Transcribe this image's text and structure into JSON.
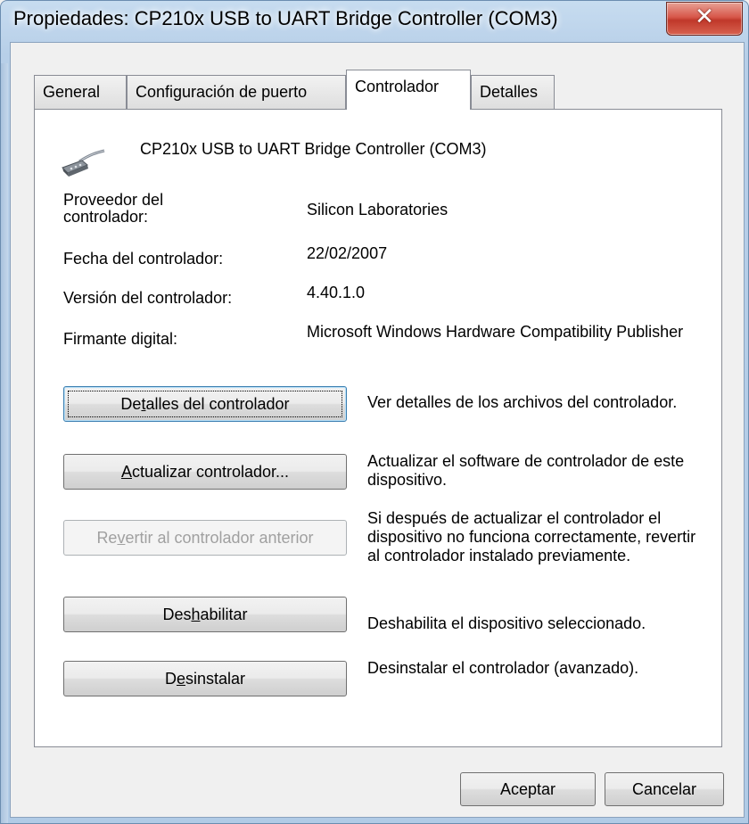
{
  "window": {
    "title": "Propiedades: CP210x USB to UART Bridge Controller (COM3)",
    "close_glyph": "✕"
  },
  "tabs": [
    {
      "label": "General",
      "active": false
    },
    {
      "label": "Configuración de puerto",
      "active": false
    },
    {
      "label": "Controlador",
      "active": true
    },
    {
      "label": "Detalles",
      "active": false
    }
  ],
  "device": {
    "icon": "serial-port-icon",
    "name": "CP210x USB to UART Bridge Controller (COM3)"
  },
  "properties": [
    {
      "label": "Proveedor del controlador:",
      "value": "Silicon Laboratories"
    },
    {
      "label": "Fecha del controlador:",
      "value": "22/02/2007"
    },
    {
      "label": "Versión del controlador:",
      "value": "4.40.1.0"
    },
    {
      "label": "Firmante digital:",
      "value": "Microsoft Windows Hardware Compatibility Publisher"
    }
  ],
  "actions": {
    "details": {
      "label_pre": "De",
      "label_key": "t",
      "label_post": "alles del controlador",
      "description": "Ver detalles de los archivos del controlador."
    },
    "update": {
      "label_pre": "",
      "label_key": "A",
      "label_post": "ctualizar controlador...",
      "description": "Actualizar el software de controlador de este dispositivo."
    },
    "rollback": {
      "label_pre": "Re",
      "label_key": "v",
      "label_post": "ertir al controlador anterior",
      "description": "Si después de actualizar el controlador el dispositivo no funciona correctamente, revertir al controlador instalado previamente.",
      "enabled": false
    },
    "disable": {
      "label_pre": "Des",
      "label_key": "h",
      "label_post": "abilitar",
      "description": "Deshabilita el dispositivo seleccionado."
    },
    "uninstall": {
      "label_pre": "D",
      "label_key": "e",
      "label_post": "sinstalar",
      "description": "Desinstalar el controlador (avanzado)."
    }
  },
  "footer": {
    "ok_label": "Aceptar",
    "cancel_label": "Cancelar"
  }
}
